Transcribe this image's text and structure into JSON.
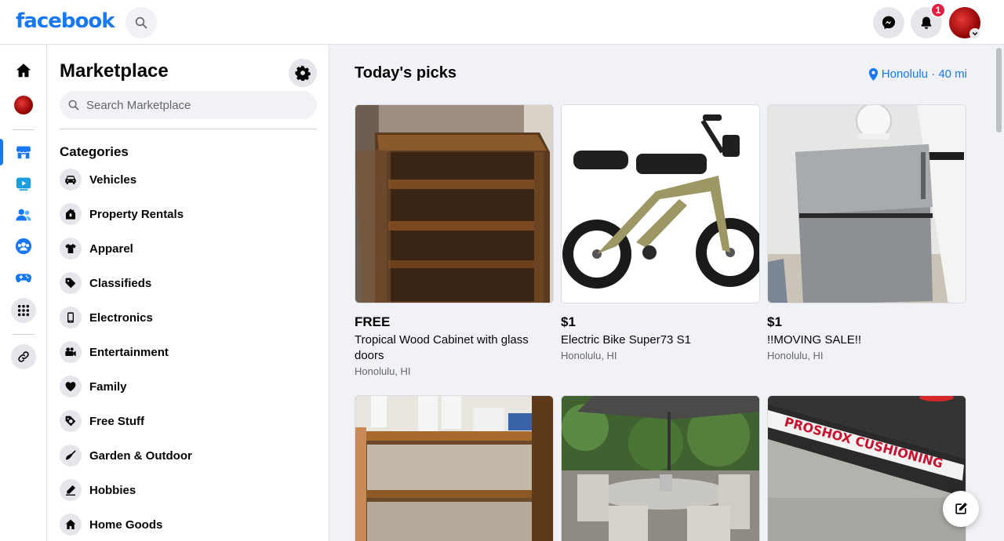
{
  "header": {
    "logo_text": "facebook",
    "notification_count": "1",
    "icons": [
      "search-icon",
      "messenger-icon",
      "bell-icon",
      "avatar",
      "chevron-down-icon"
    ]
  },
  "rail": {
    "items": [
      "home-icon",
      "profile-avatar",
      "marketplace-icon",
      "watch-icon",
      "friends-icon",
      "groups-icon",
      "gaming-icon",
      "menu-grid-icon",
      "link-icon"
    ]
  },
  "panel": {
    "title": "Marketplace",
    "search_placeholder": "Search Marketplace",
    "categories_heading": "Categories",
    "categories": [
      {
        "label": "Vehicles",
        "icon": "car-icon"
      },
      {
        "label": "Property Rentals",
        "icon": "house-icon"
      },
      {
        "label": "Apparel",
        "icon": "shirt-icon"
      },
      {
        "label": "Classifieds",
        "icon": "tag-icon"
      },
      {
        "label": "Electronics",
        "icon": "phone-icon"
      },
      {
        "label": "Entertainment",
        "icon": "camera-icon"
      },
      {
        "label": "Family",
        "icon": "heart-icon"
      },
      {
        "label": "Free Stuff",
        "icon": "free-tag-icon"
      },
      {
        "label": "Garden & Outdoor",
        "icon": "shovel-icon"
      },
      {
        "label": "Hobbies",
        "icon": "pencil-icon"
      },
      {
        "label": "Home Goods",
        "icon": "home-goods-icon"
      }
    ]
  },
  "main": {
    "title": "Today's picks",
    "location": "Honolulu · 40 mi",
    "listings": [
      {
        "price": "FREE",
        "title": "Tropical Wood Cabinet with glass doors",
        "location": "Honolulu, HI"
      },
      {
        "price": "$1",
        "title": "Electric Bike Super73 S1",
        "location": "Honolulu, HI"
      },
      {
        "price": "$1",
        "title": "!!MOVING SALE!!",
        "location": "Honolulu, HI"
      }
    ],
    "bottom_image_text": "PROSHOX CUSHIONING"
  },
  "colors": {
    "brand": "#1877f2",
    "badge": "#e41e3f",
    "background": "#f0f2f5"
  }
}
